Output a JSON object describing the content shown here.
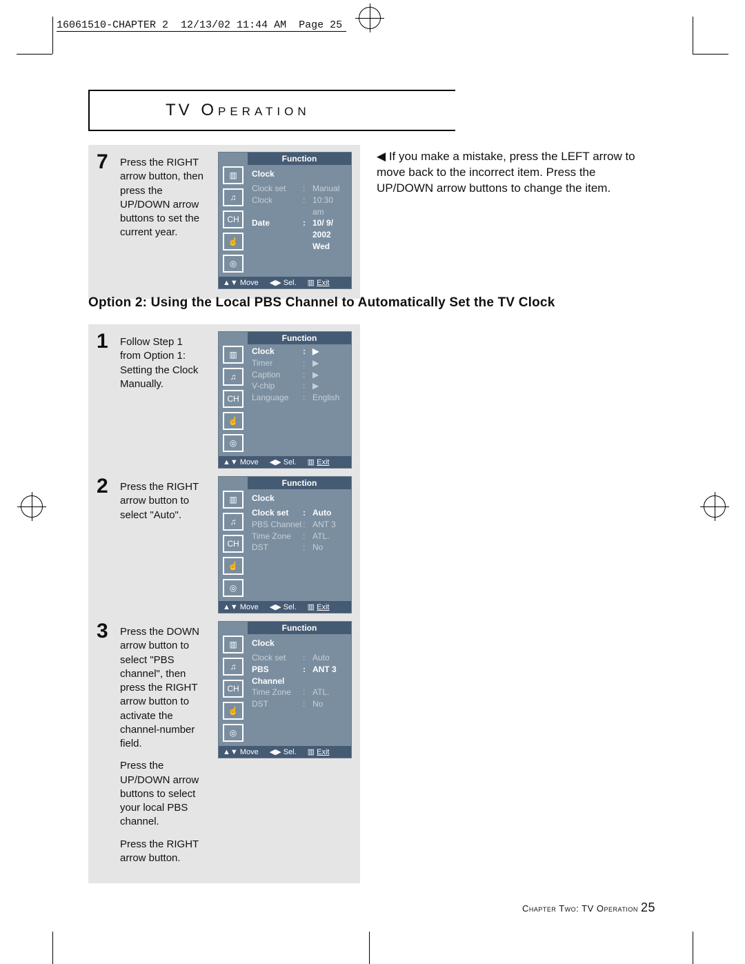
{
  "print_header": {
    "part1": "16061510-CHAPTER 2",
    "part2": "12/13/02 11:44 AM",
    "part3": "Page 25"
  },
  "section_title_tv": "TV",
  "section_title_rest": " Operation",
  "tip_text": "If you make a mistake, press the LEFT arrow to move back to the incorrect item. Press the UP/DOWN arrow buttons to change the item.",
  "tip_arrow": "◀",
  "option_header": "Option 2: Using the Local PBS Channel to Automatically Set the TV Clock",
  "footer": {
    "chapter": "Chapter Two: TV Operation",
    "page": "25"
  },
  "hintbar": {
    "move": "▲▼ Move",
    "sel": "◀▶ Sel.",
    "exit_icon": "▥",
    "exit": "Exit"
  },
  "icons": [
    "▥",
    "♫",
    "CH",
    "☝",
    "◎"
  ],
  "steps": {
    "s7": {
      "num": "7",
      "text": "Press the RIGHT arrow button, then press the UP/DOWN arrow buttons to set the current year.",
      "title": "Function",
      "hdr": "Clock",
      "rows": [
        {
          "k": "Clock set",
          "v": "Manual",
          "style": "dim"
        },
        {
          "k": "Clock",
          "v": "10:30 am",
          "style": "dim"
        },
        {
          "k": "Date",
          "v": "10/ 9/ 2002",
          "style": "hl"
        },
        {
          "k": "",
          "v": "Wed",
          "style": "hl"
        }
      ]
    },
    "s1": {
      "num": "1",
      "text": "Follow Step 1 from Option 1: Setting the Clock Manually.",
      "title": "Function",
      "hdr": "",
      "rows": [
        {
          "k": "Clock",
          "v": "▶",
          "style": "hl"
        },
        {
          "k": "Timer",
          "v": "▶",
          "style": "dim"
        },
        {
          "k": "Caption",
          "v": "▶",
          "style": "dim"
        },
        {
          "k": "V-chip",
          "v": "▶",
          "style": "dim"
        },
        {
          "k": "Language",
          "v": "English",
          "style": "dim",
          "colon": ":"
        }
      ]
    },
    "s2": {
      "num": "2",
      "text": "Press the RIGHT arrow button to select \"Auto\".",
      "title": "Function",
      "hdr": "Clock",
      "rows": [
        {
          "k": "Clock set",
          "v": "Auto",
          "style": "hl",
          "colon": ":"
        },
        {
          "k": "PBS Channel",
          "v": "ANT 3",
          "style": "dim",
          "colon": ":"
        },
        {
          "k": "Time Zone",
          "v": "ATL.",
          "style": "dim",
          "colon": ":"
        },
        {
          "k": "DST",
          "v": "No",
          "style": "dim",
          "colon": ":"
        }
      ]
    },
    "s3": {
      "num": "3",
      "text1": "Press the DOWN arrow button to select \"PBS channel\", then press the RIGHT arrow button to activate the channel-number field.",
      "text2": "Press the UP/DOWN arrow buttons to select your local PBS channel.",
      "text3": "Press the RIGHT arrow button.",
      "title": "Function",
      "hdr": "Clock",
      "rows": [
        {
          "k": "Clock set",
          "v": "Auto",
          "style": "dim",
          "colon": ":"
        },
        {
          "k": "PBS Channel",
          "v": "ANT 3",
          "style": "hl",
          "colon": ":"
        },
        {
          "k": "Time Zone",
          "v": "ATL.",
          "style": "dim",
          "colon": ":"
        },
        {
          "k": "DST",
          "v": "No",
          "style": "dim",
          "colon": ":"
        }
      ]
    }
  }
}
